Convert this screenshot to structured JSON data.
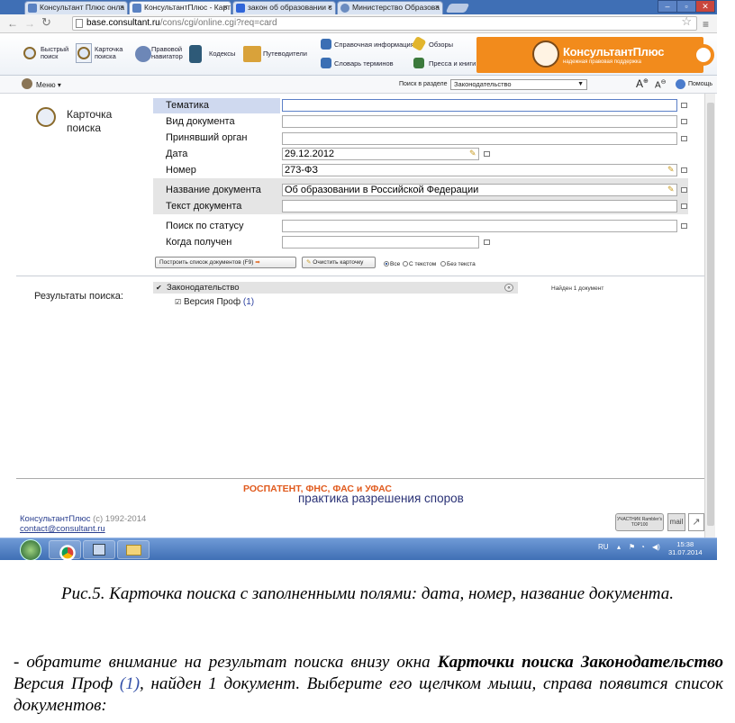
{
  "browser": {
    "tabs": [
      {
        "label": "Консультант Плюс онла"
      },
      {
        "label": "КонсультантПлюс - Карт"
      },
      {
        "label": "закон об образовании с"
      },
      {
        "label": "Министерство Образова"
      }
    ],
    "tab_close": "×",
    "url_domain": "base.consultant.ru",
    "url_path": "/cons/cgi/online.cgi?req=card"
  },
  "toolbar": {
    "quick_search": "Быстрый поиск",
    "search_card": "Карточка поиска",
    "legal_navigator": "Правовой навигатор",
    "codes": "Кодексы",
    "guides": "Путеводители",
    "reference_info": "Справочная информация",
    "reviews": "Обзоры",
    "terms_dictionary": "Словарь терминов",
    "press_books": "Пресса и книги",
    "brand_logo": "КонсультантПлюс",
    "brand_slogan": "надежная правовая поддержка"
  },
  "menubar": {
    "menu": "Меню",
    "search_in_section": "Поиск в разделе",
    "section_selected": "Законодательство",
    "help": "Помощь"
  },
  "card": {
    "title": "Карточка поиска",
    "fields": [
      {
        "label": "Тематика",
        "value": ""
      },
      {
        "label": "Вид документа",
        "value": ""
      },
      {
        "label": "Принявший орган",
        "value": ""
      },
      {
        "label": "Дата",
        "value": "29.12.2012"
      },
      {
        "label": "Номер",
        "value": "273-ФЗ"
      },
      {
        "label": "Название документа",
        "value": "Об образовании в Российской Федерации"
      },
      {
        "label": "Текст документа",
        "value": ""
      },
      {
        "label": "Поиск по статусу",
        "value": ""
      },
      {
        "label": "Когда получен",
        "value": ""
      }
    ],
    "build_list_button": "Построить список документов (F9)",
    "clear_card_button": "Очистить карточку",
    "radio_all": "Все",
    "radio_with_text": "С текстом",
    "radio_without_text": "Без текста"
  },
  "results": {
    "label": "Результаты поиска:",
    "group": "Законодательство",
    "found": "Найден 1 документ",
    "item_name": "Версия Проф",
    "item_count": "(1)"
  },
  "footer": {
    "ad_line1": "РОСПАТЕНТ, ФНС, ФАС и УФАС",
    "ad_line2": "практика разрешения споров",
    "copyright_brand": "КонсультантПлюс",
    "copyright_years": "(c) 1992-2014",
    "email": "contact@consultant.ru",
    "badge_rambler": "УЧАСТНИК Rambler's TOP100",
    "badge_mail": "mail"
  },
  "taskbar": {
    "lang": "RU",
    "time": "15:38",
    "date": "31.07.2014"
  },
  "caption": {
    "figure": "Рис.5. Карточка поиска с заполненными полями: дата, номер, название документа.",
    "p_start": "- обратите внимание на результат поиска внизу окна ",
    "p_bold": "Карточки поиска Законодательство",
    "p_mid": " Версия Проф ",
    "p_blue": "(1)",
    "p_end": ", найден 1 документ. Выберите его щелчком мыши, справа появится список документов:"
  }
}
